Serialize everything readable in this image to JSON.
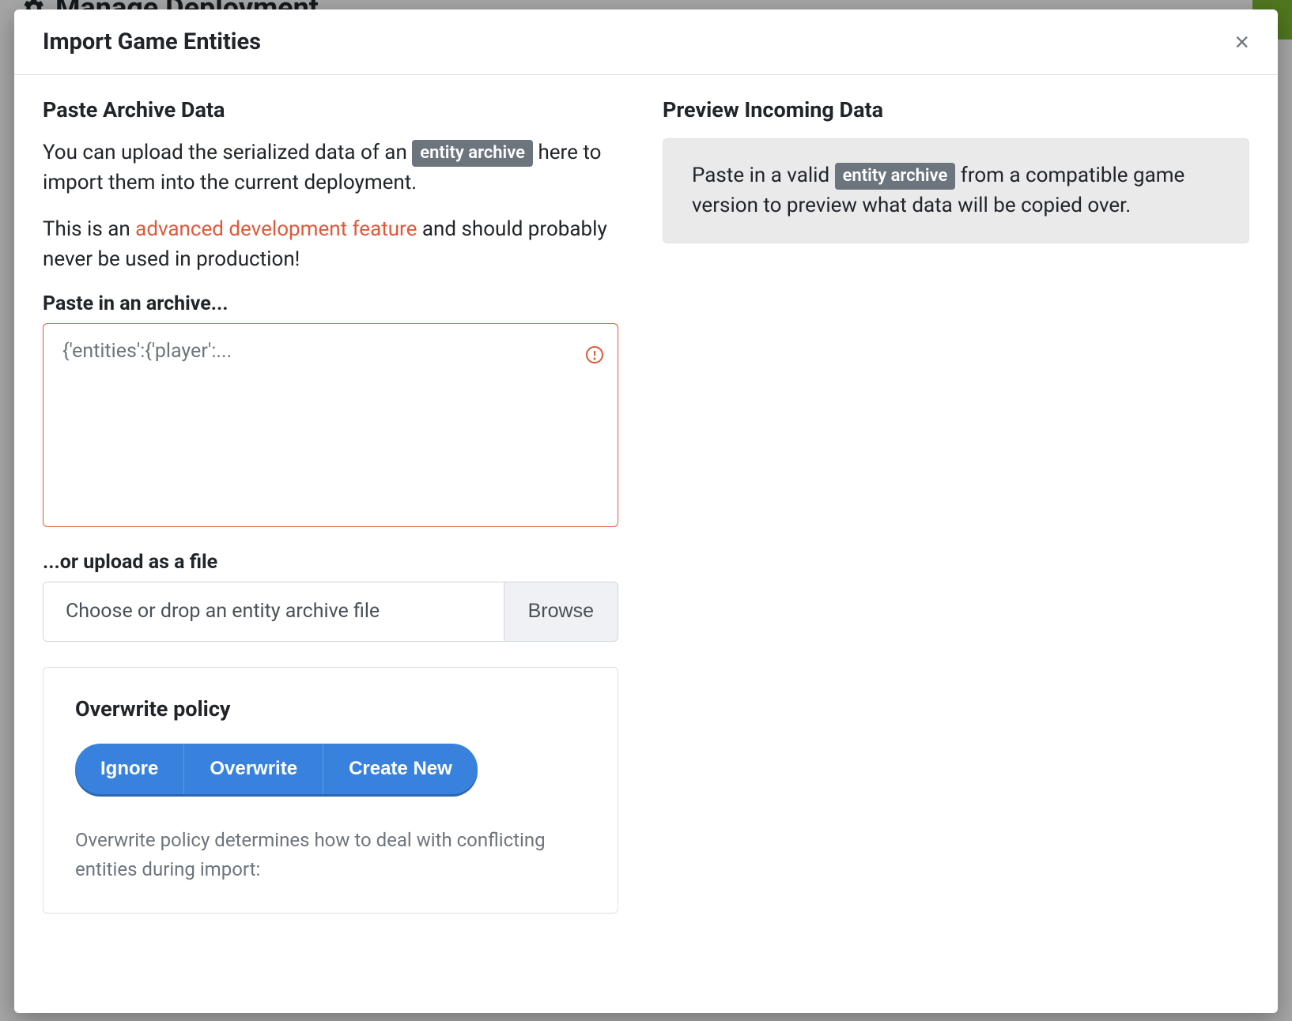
{
  "background": {
    "page_title": "Manage Deployment"
  },
  "modal": {
    "title": "Import Game Entities",
    "close_label": "×"
  },
  "left": {
    "heading": "Paste Archive Data",
    "intro_prefix": "You can upload the serialized data of an ",
    "badge": "entity archive",
    "intro_suffix": " here to import them into the current deployment.",
    "warning_prefix": "This is an ",
    "warning_link": "advanced development feature",
    "warning_suffix": " and should probably never be used in production!",
    "paste_label": "Paste in an archive...",
    "paste_placeholder": "{'entities':{'player':...",
    "upload_label": "...or upload as a file",
    "file_placeholder": "Choose or drop an entity archive file",
    "browse_label": "Browse",
    "policy": {
      "title": "Overwrite policy",
      "options": [
        "Ignore",
        "Overwrite",
        "Create New"
      ],
      "description": "Overwrite policy determines how to deal with conflicting entities during import:"
    }
  },
  "right": {
    "heading": "Preview Incoming Data",
    "preview_prefix": "Paste in a valid ",
    "preview_badge": "entity archive",
    "preview_suffix": " from a compatible game version to preview what data will be copied over."
  }
}
